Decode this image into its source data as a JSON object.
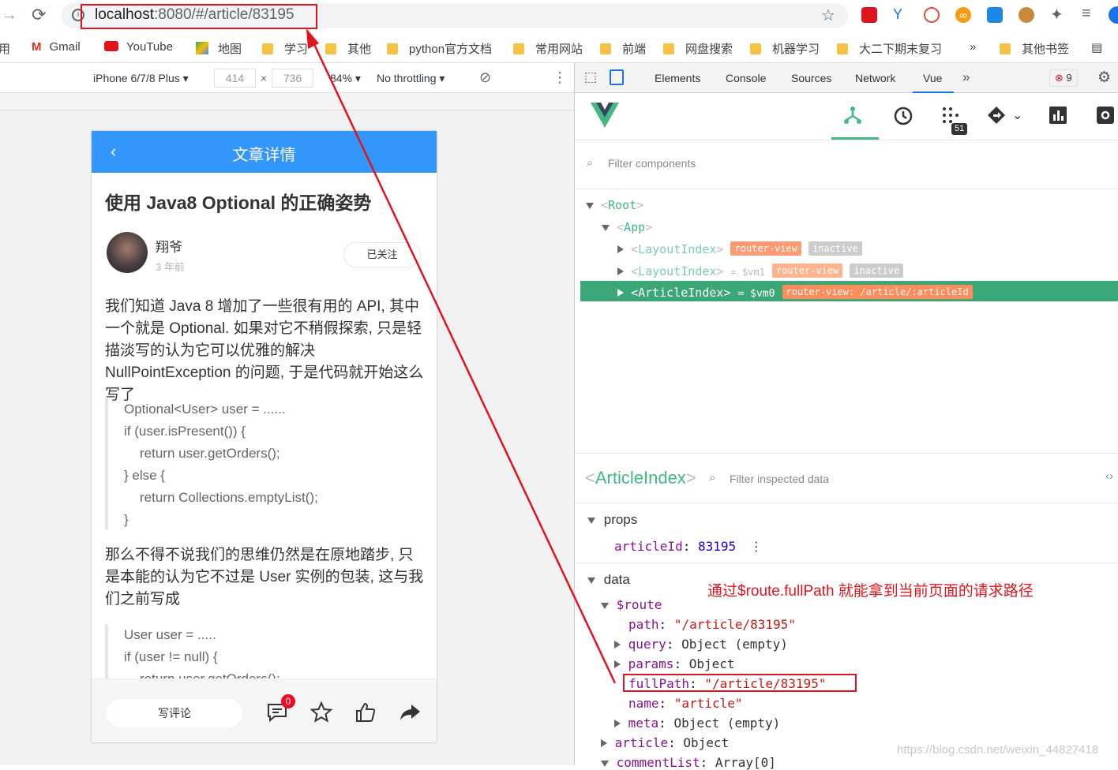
{
  "browser": {
    "url_host": "localhost",
    "url_rest": ":8080/#/article/83195",
    "bookmarks": [
      "应用",
      "Gmail",
      "YouTube",
      "地图",
      "学习",
      "其他",
      "python官方文档",
      "常用网站",
      "前端",
      "网盘搜索",
      "机器学习",
      "大二下期末复习",
      "»",
      "其他书签"
    ]
  },
  "device_toolbar": {
    "device": "iPhone 6/7/8 Plus",
    "width": "414",
    "height": "736",
    "zoom": "84%",
    "throttle": "No throttling"
  },
  "app": {
    "nav_title": "文章详情",
    "article_title": "使用 Java8 Optional 的正确姿势",
    "author": "翔爷",
    "time": "3 年前",
    "follow_label": "已关注",
    "para1": "我们知道 Java 8 增加了一些很有用的 API, 其中一个就是 Optional. 如果对它不稍假探索, 只是轻描淡写的认为它可以优雅的解决 NullPointException 的问题, 于是代码就开始这么写了",
    "code1": [
      "Optional<User> user = ......",
      "if (user.isPresent()) {",
      "    return user.getOrders();",
      "} else {",
      "    return Collections.emptyList();",
      "}"
    ],
    "para2": "那么不得不说我们的思维仍然是在原地踏步, 只是本能的认为它不过是 User 实例的包装, 这与我们之前写成",
    "code2": [
      "User user = .....",
      "if (user != null) {",
      "    return user.getOrders();"
    ],
    "comment_button": "写评论",
    "comment_count": "0"
  },
  "devtools": {
    "tabs": [
      "Elements",
      "Console",
      "Sources",
      "Network",
      "Vue"
    ],
    "active_tab": "Vue",
    "error_count": "9",
    "vue_badge": "51",
    "filter_components": "Filter components",
    "tree": {
      "root": "Root",
      "app": "App",
      "layout1": "LayoutIndex",
      "layout2": "LayoutIndex",
      "layout2_var": "= $vm1",
      "article": "ArticleIndex",
      "article_var": "= $vm0",
      "tag_router_view": "router-view",
      "tag_inactive": "inactive",
      "tag_article_route": "router-view: /article/:articleId"
    },
    "inspector": {
      "component": "ArticleIndex",
      "filter": "Filter inspected data",
      "props_label": "props",
      "article_id_key": "articleId",
      "article_id_val": "83195",
      "data_label": "data",
      "route_key": "$route",
      "path_key": "path",
      "path_val": "\"/article/83195\"",
      "query_key": "query",
      "query_val": "Object (empty)",
      "params_key": "params",
      "params_val": "Object",
      "fullpath_key": "fullPath",
      "fullpath_val": "\"/article/83195\"",
      "name_key": "name",
      "name_val": "\"article\"",
      "meta_key": "meta",
      "meta_val": "Object (empty)",
      "article_key": "article",
      "article_val": "Object",
      "commentlist_key": "commentList",
      "commentlist_val": "Array[0]"
    }
  },
  "annotation": {
    "note": "通过$route.fullPath 就能拿到当前页面的请求路径",
    "color": "#e0141e"
  },
  "watermark": "https://blog.csdn.net/weixin_44827418"
}
